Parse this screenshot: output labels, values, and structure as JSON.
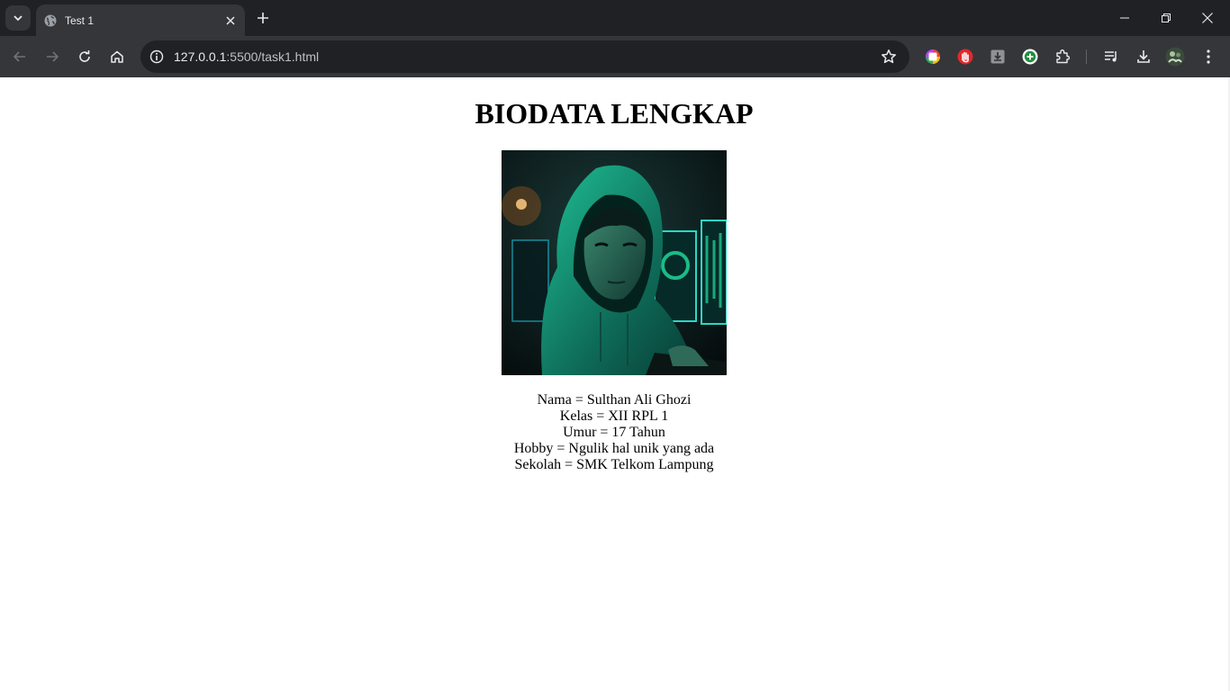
{
  "browser": {
    "tab": {
      "title": "Test 1"
    },
    "address": {
      "host": "127.0.0.1",
      "rest": ":5500/task1.html"
    },
    "icons": {
      "tab_search": "chevron-down-icon",
      "favicon": "globe-icon",
      "tab_close": "close-icon",
      "new_tab": "plus-icon",
      "back": "arrow-left-icon",
      "forward": "arrow-right-icon",
      "reload": "reload-icon",
      "home": "home-icon",
      "site_info": "info-icon",
      "bookmark": "star-icon",
      "extensions": [
        "color-picker-extension-icon",
        "stop-hand-extension-icon",
        "download-extension-icon",
        "plus-circle-extension-icon",
        "puzzle-extensions-icon"
      ],
      "media": "media-queue-icon",
      "downloads": "download-icon",
      "profile": "profile-avatar-icon",
      "menu": "kebab-menu-icon"
    },
    "colors": {
      "frame": "#202124",
      "toolbar": "#35363a",
      "omnibox": "#202124",
      "text": "#e8eaed"
    }
  },
  "page": {
    "heading": "BIODATA LENGKAP",
    "photo": {
      "description_icon": "profile-photo"
    },
    "bio": [
      "Nama = Sulthan Ali Ghozi",
      "Kelas = XII RPL 1",
      "Umur = 17 Tahun",
      "Hobby = Ngulik hal unik yang ada",
      "Sekolah = SMK Telkom Lampung"
    ]
  }
}
